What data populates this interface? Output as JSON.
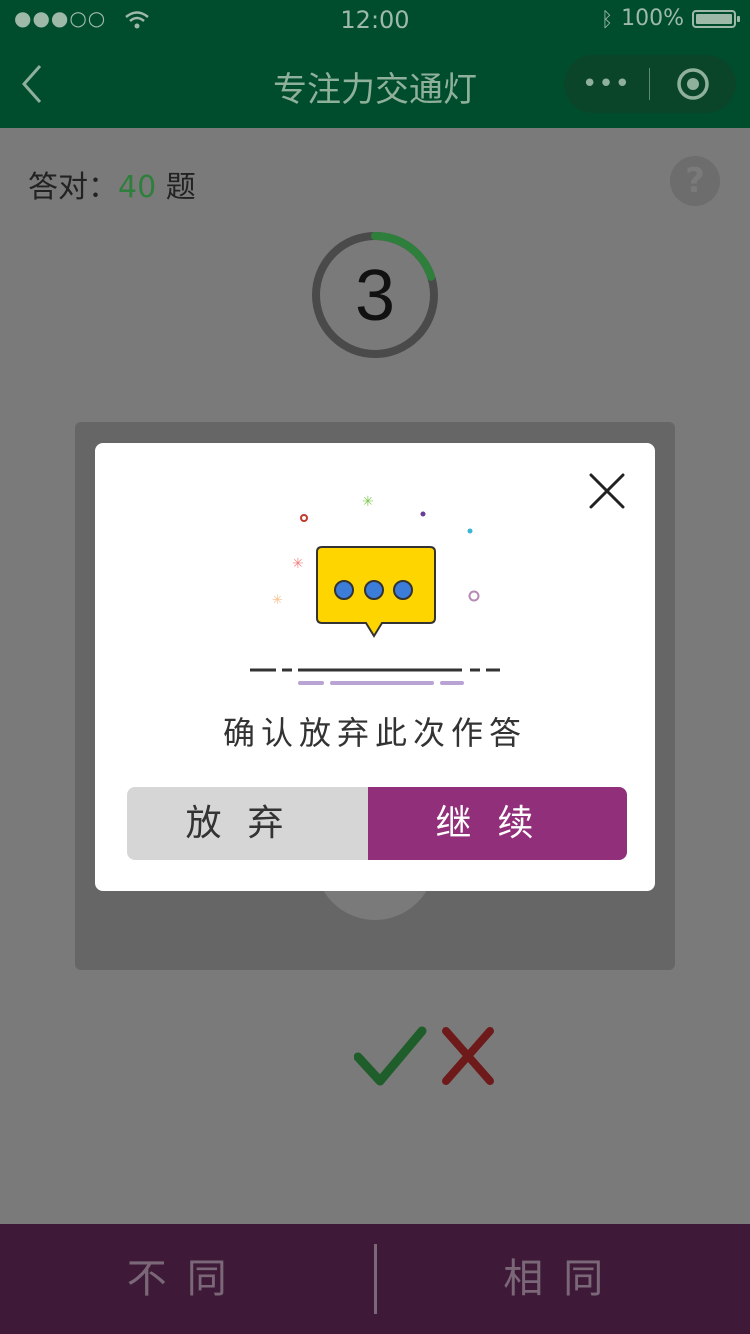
{
  "status_bar": {
    "signal": "●●●○○",
    "time": "12:00",
    "battery_text": "100%"
  },
  "nav": {
    "title": "专注力交通灯",
    "back_icon": "chevron-left-icon",
    "more_icon": "•••",
    "target_icon": "target-icon"
  },
  "score": {
    "label": "答对：",
    "value": "40",
    "unit": " 题"
  },
  "help_label": "?",
  "timer": {
    "value": "3",
    "progress": 0.2
  },
  "modal": {
    "message": "确认放弃此次作答",
    "abandon_label": "放弃",
    "continue_label": "继续"
  },
  "bottom": {
    "different_label": "不同",
    "same_label": "相同"
  },
  "colors": {
    "green": "#2f7f3c",
    "purple": "#922f7b",
    "red": "#b02a2a"
  }
}
